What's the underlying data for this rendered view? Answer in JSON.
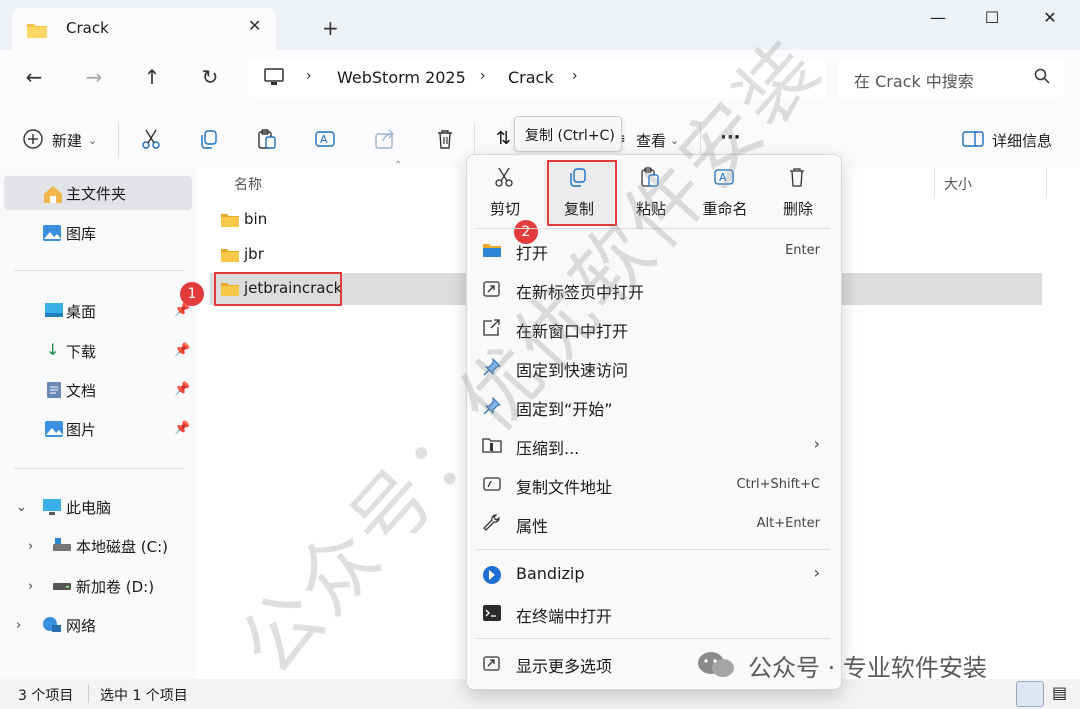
{
  "window": {
    "tab_title": "Crack",
    "new_tab": "+",
    "minimize": "—",
    "maximize": "☐",
    "close": "✕"
  },
  "nav": {
    "breadcrumb": [
      "WebStorm 2025",
      "Crack"
    ],
    "search_placeholder": "在 Crack 中搜索"
  },
  "toolbar": {
    "new_label": "新建",
    "sort_label": "⇅",
    "view_label": "查看",
    "more_label": "···",
    "details_label": "详细信息"
  },
  "sidebar": {
    "home": "主文件夹",
    "gallery": "图库",
    "pinned": [
      "桌面",
      "下载",
      "文档",
      "图片"
    ],
    "this_pc": "此电脑",
    "drives": [
      "本地磁盘 (C:)",
      "新加卷 (D:)"
    ],
    "network": "网络"
  },
  "columns": {
    "name": "名称",
    "size": "大小"
  },
  "files": [
    "bin",
    "jbr",
    "jetbraincrack"
  ],
  "status": {
    "count": "3 个项目",
    "selected": "选中 1 个项目"
  },
  "tooltip": "复制 (Ctrl+C)",
  "quick_actions": [
    "剪切",
    "复制",
    "粘贴",
    "重命名",
    "删除"
  ],
  "menu_items": [
    {
      "label": "打开",
      "shortcut": "Enter"
    },
    {
      "label": "在新标签页中打开",
      "shortcut": ""
    },
    {
      "label": "在新窗口中打开",
      "shortcut": ""
    },
    {
      "label": "固定到快速访问",
      "shortcut": ""
    },
    {
      "label": "固定到“开始”",
      "shortcut": ""
    },
    {
      "label": "压缩到...",
      "shortcut": ""
    },
    {
      "label": "复制文件地址",
      "shortcut": "Ctrl+Shift+C"
    },
    {
      "label": "属性",
      "shortcut": "Alt+Enter"
    },
    {
      "label": "Bandizip",
      "shortcut": ""
    },
    {
      "label": "在终端中打开",
      "shortcut": ""
    },
    {
      "label": "显示更多选项",
      "shortcut": ""
    }
  ],
  "annotations": {
    "step1": "1",
    "step2": "2"
  },
  "watermark": "公众号：优优软件安装",
  "footer": "公众号 · 专业软件安装",
  "colors": {
    "accent": "#005fb8",
    "highlight": "#e23b3b",
    "folder": "#f6c14b"
  }
}
